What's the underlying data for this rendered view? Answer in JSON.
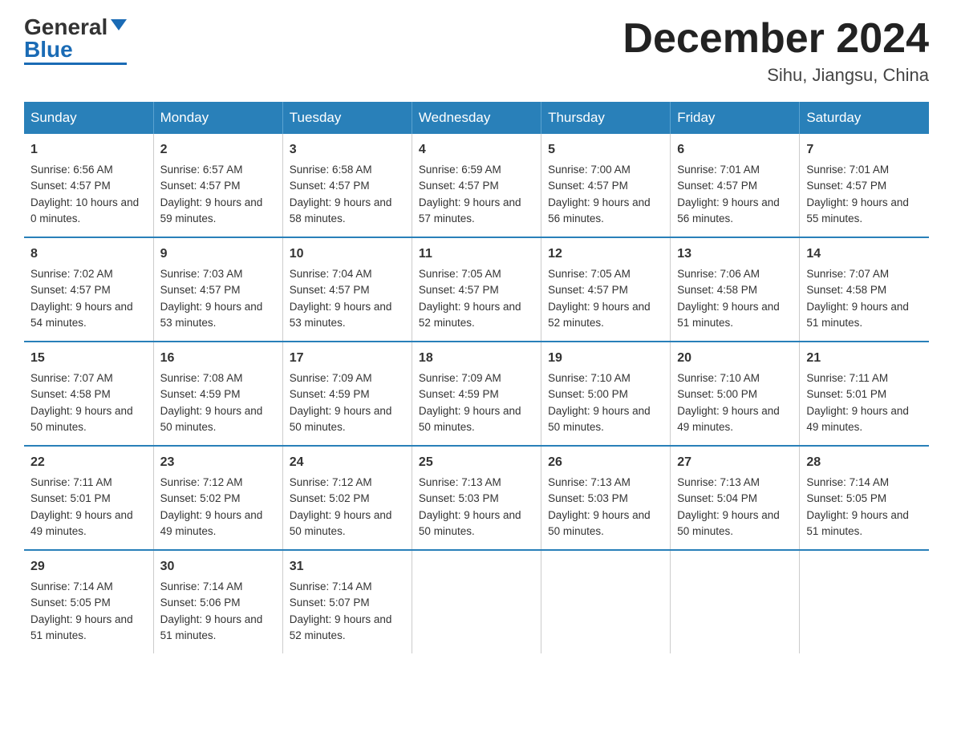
{
  "header": {
    "logo": {
      "general": "General",
      "blue": "Blue"
    },
    "title": "December 2024",
    "location": "Sihu, Jiangsu, China"
  },
  "weekdays": [
    "Sunday",
    "Monday",
    "Tuesday",
    "Wednesday",
    "Thursday",
    "Friday",
    "Saturday"
  ],
  "weeks": [
    [
      {
        "day": "1",
        "sunrise": "6:56 AM",
        "sunset": "4:57 PM",
        "daylight": "10 hours and 0 minutes."
      },
      {
        "day": "2",
        "sunrise": "6:57 AM",
        "sunset": "4:57 PM",
        "daylight": "9 hours and 59 minutes."
      },
      {
        "day": "3",
        "sunrise": "6:58 AM",
        "sunset": "4:57 PM",
        "daylight": "9 hours and 58 minutes."
      },
      {
        "day": "4",
        "sunrise": "6:59 AM",
        "sunset": "4:57 PM",
        "daylight": "9 hours and 57 minutes."
      },
      {
        "day": "5",
        "sunrise": "7:00 AM",
        "sunset": "4:57 PM",
        "daylight": "9 hours and 56 minutes."
      },
      {
        "day": "6",
        "sunrise": "7:01 AM",
        "sunset": "4:57 PM",
        "daylight": "9 hours and 56 minutes."
      },
      {
        "day": "7",
        "sunrise": "7:01 AM",
        "sunset": "4:57 PM",
        "daylight": "9 hours and 55 minutes."
      }
    ],
    [
      {
        "day": "8",
        "sunrise": "7:02 AM",
        "sunset": "4:57 PM",
        "daylight": "9 hours and 54 minutes."
      },
      {
        "day": "9",
        "sunrise": "7:03 AM",
        "sunset": "4:57 PM",
        "daylight": "9 hours and 53 minutes."
      },
      {
        "day": "10",
        "sunrise": "7:04 AM",
        "sunset": "4:57 PM",
        "daylight": "9 hours and 53 minutes."
      },
      {
        "day": "11",
        "sunrise": "7:05 AM",
        "sunset": "4:57 PM",
        "daylight": "9 hours and 52 minutes."
      },
      {
        "day": "12",
        "sunrise": "7:05 AM",
        "sunset": "4:57 PM",
        "daylight": "9 hours and 52 minutes."
      },
      {
        "day": "13",
        "sunrise": "7:06 AM",
        "sunset": "4:58 PM",
        "daylight": "9 hours and 51 minutes."
      },
      {
        "day": "14",
        "sunrise": "7:07 AM",
        "sunset": "4:58 PM",
        "daylight": "9 hours and 51 minutes."
      }
    ],
    [
      {
        "day": "15",
        "sunrise": "7:07 AM",
        "sunset": "4:58 PM",
        "daylight": "9 hours and 50 minutes."
      },
      {
        "day": "16",
        "sunrise": "7:08 AM",
        "sunset": "4:59 PM",
        "daylight": "9 hours and 50 minutes."
      },
      {
        "day": "17",
        "sunrise": "7:09 AM",
        "sunset": "4:59 PM",
        "daylight": "9 hours and 50 minutes."
      },
      {
        "day": "18",
        "sunrise": "7:09 AM",
        "sunset": "4:59 PM",
        "daylight": "9 hours and 50 minutes."
      },
      {
        "day": "19",
        "sunrise": "7:10 AM",
        "sunset": "5:00 PM",
        "daylight": "9 hours and 50 minutes."
      },
      {
        "day": "20",
        "sunrise": "7:10 AM",
        "sunset": "5:00 PM",
        "daylight": "9 hours and 49 minutes."
      },
      {
        "day": "21",
        "sunrise": "7:11 AM",
        "sunset": "5:01 PM",
        "daylight": "9 hours and 49 minutes."
      }
    ],
    [
      {
        "day": "22",
        "sunrise": "7:11 AM",
        "sunset": "5:01 PM",
        "daylight": "9 hours and 49 minutes."
      },
      {
        "day": "23",
        "sunrise": "7:12 AM",
        "sunset": "5:02 PM",
        "daylight": "9 hours and 49 minutes."
      },
      {
        "day": "24",
        "sunrise": "7:12 AM",
        "sunset": "5:02 PM",
        "daylight": "9 hours and 50 minutes."
      },
      {
        "day": "25",
        "sunrise": "7:13 AM",
        "sunset": "5:03 PM",
        "daylight": "9 hours and 50 minutes."
      },
      {
        "day": "26",
        "sunrise": "7:13 AM",
        "sunset": "5:03 PM",
        "daylight": "9 hours and 50 minutes."
      },
      {
        "day": "27",
        "sunrise": "7:13 AM",
        "sunset": "5:04 PM",
        "daylight": "9 hours and 50 minutes."
      },
      {
        "day": "28",
        "sunrise": "7:14 AM",
        "sunset": "5:05 PM",
        "daylight": "9 hours and 51 minutes."
      }
    ],
    [
      {
        "day": "29",
        "sunrise": "7:14 AM",
        "sunset": "5:05 PM",
        "daylight": "9 hours and 51 minutes."
      },
      {
        "day": "30",
        "sunrise": "7:14 AM",
        "sunset": "5:06 PM",
        "daylight": "9 hours and 51 minutes."
      },
      {
        "day": "31",
        "sunrise": "7:14 AM",
        "sunset": "5:07 PM",
        "daylight": "9 hours and 52 minutes."
      },
      {
        "day": "",
        "sunrise": "",
        "sunset": "",
        "daylight": ""
      },
      {
        "day": "",
        "sunrise": "",
        "sunset": "",
        "daylight": ""
      },
      {
        "day": "",
        "sunrise": "",
        "sunset": "",
        "daylight": ""
      },
      {
        "day": "",
        "sunrise": "",
        "sunset": "",
        "daylight": ""
      }
    ]
  ],
  "labels": {
    "sunrise": "Sunrise:",
    "sunset": "Sunset:",
    "daylight": "Daylight:"
  }
}
